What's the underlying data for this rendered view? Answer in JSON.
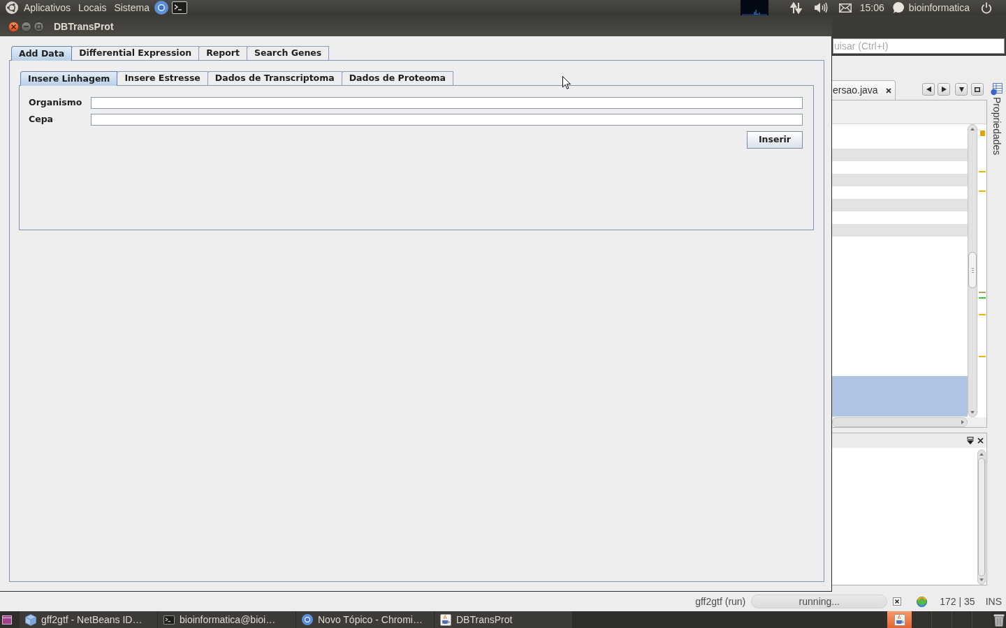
{
  "top_panel": {
    "menus": [
      "Aplicativos",
      "Locais",
      "Sistema"
    ],
    "clock": "15:06",
    "user": "bioinformatica"
  },
  "window": {
    "title": "DBTransProt",
    "tabs": [
      {
        "label": "Add Data",
        "selected": true
      },
      {
        "label": "Differential Expression",
        "selected": false
      },
      {
        "label": "Report",
        "selected": false
      },
      {
        "label": "Search Genes",
        "selected": false
      }
    ],
    "subtabs": [
      {
        "label": "Insere Linhagem",
        "selected": true
      },
      {
        "label": "Insere Estresse",
        "selected": false
      },
      {
        "label": "Dados de Transcriptoma",
        "selected": false
      },
      {
        "label": "Dados de Proteoma",
        "selected": false
      }
    ],
    "fields": [
      {
        "label": "Organismo"
      },
      {
        "label": "Cepa"
      }
    ],
    "submit_button": "Inserir"
  },
  "ide": {
    "search": {
      "placeholder": "uisar (Ctrl+I)"
    },
    "editor_tabs": [
      {
        "label": "ersao.java"
      }
    ],
    "side_panel": "Propriedades",
    "status_bar": {
      "task": "gff2gtf (run)",
      "progress": "running...",
      "position": "172 | 35",
      "mode": "INS"
    }
  },
  "taskbar": {
    "items": [
      {
        "kind": "netbeans",
        "label": "gff2gtf - NetBeans ID…"
      },
      {
        "kind": "terminal",
        "label": "bioinformatica@bioi…"
      },
      {
        "kind": "browser",
        "label": "Novo Tópico - Chromi…"
      },
      {
        "kind": "java",
        "label": "DBTransProt"
      }
    ]
  }
}
